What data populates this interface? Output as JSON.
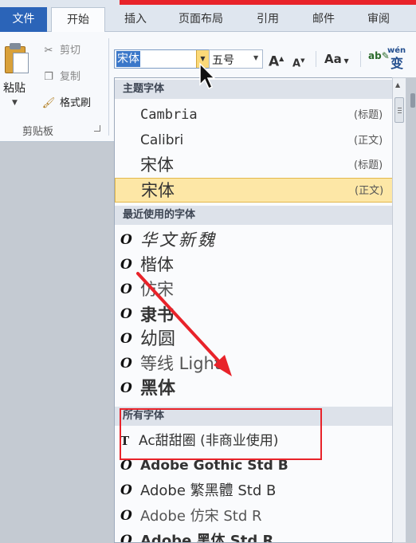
{
  "tabs": [
    {
      "label": "文件",
      "active": false
    },
    {
      "label": "开始",
      "active": true
    },
    {
      "label": "插入",
      "active": false
    },
    {
      "label": "页面布局",
      "active": false
    },
    {
      "label": "引用",
      "active": false
    },
    {
      "label": "邮件",
      "active": false
    },
    {
      "label": "审阅",
      "active": false
    }
  ],
  "clipboard": {
    "paste_label": "粘贴",
    "cut_label": "剪切",
    "copy_label": "复制",
    "format_painter_label": "格式刷",
    "group_label": "剪贴板"
  },
  "font_controls": {
    "font_name": "宋体",
    "font_size": "五号",
    "grow_label": "A",
    "shrink_label": "A",
    "change_case_label": "Aa",
    "phonetic_top": "wén",
    "phonetic_char": "变"
  },
  "dropdown": {
    "theme_header": "主题字体",
    "theme_fonts": [
      {
        "name": "Cambria",
        "tag": "(标题)"
      },
      {
        "name": "Calibri",
        "tag": "(正文)"
      },
      {
        "name": "宋体",
        "tag": "(标题)"
      },
      {
        "name": "宋体",
        "tag": "(正文)",
        "selected": true
      }
    ],
    "recent_header": "最近使用的字体",
    "recent_fonts": [
      {
        "name": "华文新魏"
      },
      {
        "name": "楷体"
      },
      {
        "name": "仿宋"
      },
      {
        "name": "隶书"
      },
      {
        "name": "幼圆"
      },
      {
        "name": "等线 Light"
      },
      {
        "name": "黑体"
      }
    ],
    "all_header": "所有字体",
    "all_fonts": [
      {
        "name": "Ac甜甜圈 (非商业使用)",
        "type": "truetype"
      },
      {
        "name": "Adobe Gothic Std B",
        "type": "opentype"
      },
      {
        "name": "Adobe 繁黑體 Std B",
        "type": "opentype"
      },
      {
        "name": "Adobe 仿宋 Std R",
        "type": "opentype"
      },
      {
        "name": "Adobe 黑体 Std R",
        "type": "opentype"
      }
    ],
    "opentype_glyph": "O",
    "truetype_glyph": "T"
  },
  "colors": {
    "file_tab": "#2b64b8",
    "annotation": "#e8232a",
    "selection": "#fde7a6",
    "section_header": "#dde2ea"
  }
}
